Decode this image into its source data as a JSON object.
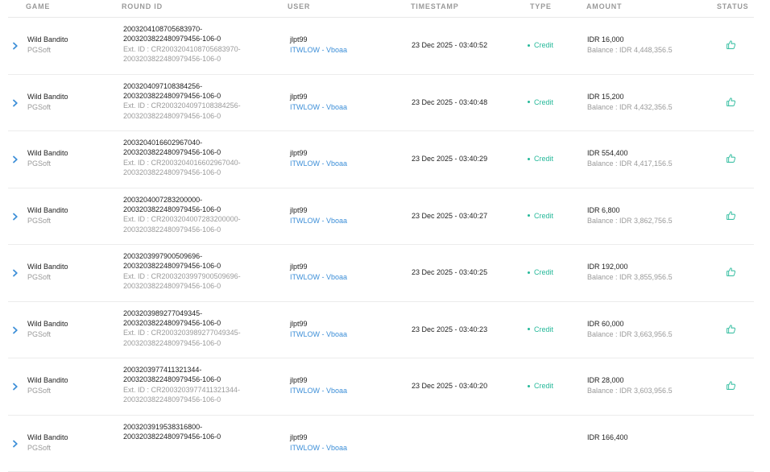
{
  "columns": {
    "game": "GAME",
    "round_id": "ROUND ID",
    "user": "USER",
    "timestamp": "TIMESTAMP",
    "type": "TYPE",
    "amount": "AMOUNT",
    "status": "STATUS"
  },
  "colors": {
    "chevron": "#3d8fd8",
    "credit": "#26b99a",
    "link": "#3d8fd8",
    "status_icon": "#26b99a"
  },
  "icons": {
    "expand": "chevron-right-icon",
    "status": "thumbs-up-icon"
  },
  "rows": [
    {
      "game": "Wild Bandito",
      "provider": "PGSoft",
      "round_line1": "2003204108705683970-",
      "round_line2": "2003203822480979456-106-0",
      "ext_line1": "Ext. ID : CR2003204108705683970-",
      "ext_line2": "2003203822480979456-106-0",
      "user": "jlpt99",
      "user_link": "ITWLOW - Vboaa",
      "timestamp": "23 Dec 2025 - 03:40:52",
      "type": "Credit",
      "amount": "IDR 16,000",
      "balance": "Balance : IDR 4,448,356.5"
    },
    {
      "game": "Wild Bandito",
      "provider": "PGSoft",
      "round_line1": "2003204097108384256-",
      "round_line2": "2003203822480979456-106-0",
      "ext_line1": "Ext. ID : CR2003204097108384256-",
      "ext_line2": "2003203822480979456-106-0",
      "user": "jlpt99",
      "user_link": "ITWLOW - Vboaa",
      "timestamp": "23 Dec 2025 - 03:40:48",
      "type": "Credit",
      "amount": "IDR 15,200",
      "balance": "Balance : IDR 4,432,356.5"
    },
    {
      "game": "Wild Bandito",
      "provider": "PGSoft",
      "round_line1": "2003204016602967040-",
      "round_line2": "2003203822480979456-106-0",
      "ext_line1": "Ext. ID : CR2003204016602967040-",
      "ext_line2": "2003203822480979456-106-0",
      "user": "jlpt99",
      "user_link": "ITWLOW - Vboaa",
      "timestamp": "23 Dec 2025 - 03:40:29",
      "type": "Credit",
      "amount": "IDR 554,400",
      "balance": "Balance : IDR 4,417,156.5"
    },
    {
      "game": "Wild Bandito",
      "provider": "PGSoft",
      "round_line1": "2003204007283200000-",
      "round_line2": "2003203822480979456-106-0",
      "ext_line1": "Ext. ID : CR2003204007283200000-",
      "ext_line2": "2003203822480979456-106-0",
      "user": "jlpt99",
      "user_link": "ITWLOW - Vboaa",
      "timestamp": "23 Dec 2025 - 03:40:27",
      "type": "Credit",
      "amount": "IDR 6,800",
      "balance": "Balance : IDR 3,862,756.5"
    },
    {
      "game": "Wild Bandito",
      "provider": "PGSoft",
      "round_line1": "2003203997900509696-",
      "round_line2": "2003203822480979456-106-0",
      "ext_line1": "Ext. ID : CR2003203997900509696-",
      "ext_line2": "2003203822480979456-106-0",
      "user": "jlpt99",
      "user_link": "ITWLOW - Vboaa",
      "timestamp": "23 Dec 2025 - 03:40:25",
      "type": "Credit",
      "amount": "IDR 192,000",
      "balance": "Balance : IDR 3,855,956.5"
    },
    {
      "game": "Wild Bandito",
      "provider": "PGSoft",
      "round_line1": "2003203989277049345-",
      "round_line2": "2003203822480979456-106-0",
      "ext_line1": "Ext. ID : CR2003203989277049345-",
      "ext_line2": "2003203822480979456-106-0",
      "user": "jlpt99",
      "user_link": "ITWLOW - Vboaa",
      "timestamp": "23 Dec 2025 - 03:40:23",
      "type": "Credit",
      "amount": "IDR 60,000",
      "balance": "Balance : IDR 3,663,956.5"
    },
    {
      "game": "Wild Bandito",
      "provider": "PGSoft",
      "round_line1": "2003203977411321344-",
      "round_line2": "2003203822480979456-106-0",
      "ext_line1": "Ext. ID : CR2003203977411321344-",
      "ext_line2": "2003203822480979456-106-0",
      "user": "jlpt99",
      "user_link": "ITWLOW - Vboaa",
      "timestamp": "23 Dec 2025 - 03:40:20",
      "type": "Credit",
      "amount": "IDR 28,000",
      "balance": "Balance : IDR 3,603,956.5"
    },
    {
      "game": "Wild Bandito",
      "provider": "PGSoft",
      "round_line1": "2003203919538316800-",
      "round_line2": "2003203822480979456-106-0",
      "ext_line1": "",
      "ext_line2": "",
      "user": "jlpt99",
      "user_link": "ITWLOW - Vboaa",
      "timestamp": "",
      "type": "",
      "amount": "IDR 166,400",
      "balance": ""
    }
  ]
}
